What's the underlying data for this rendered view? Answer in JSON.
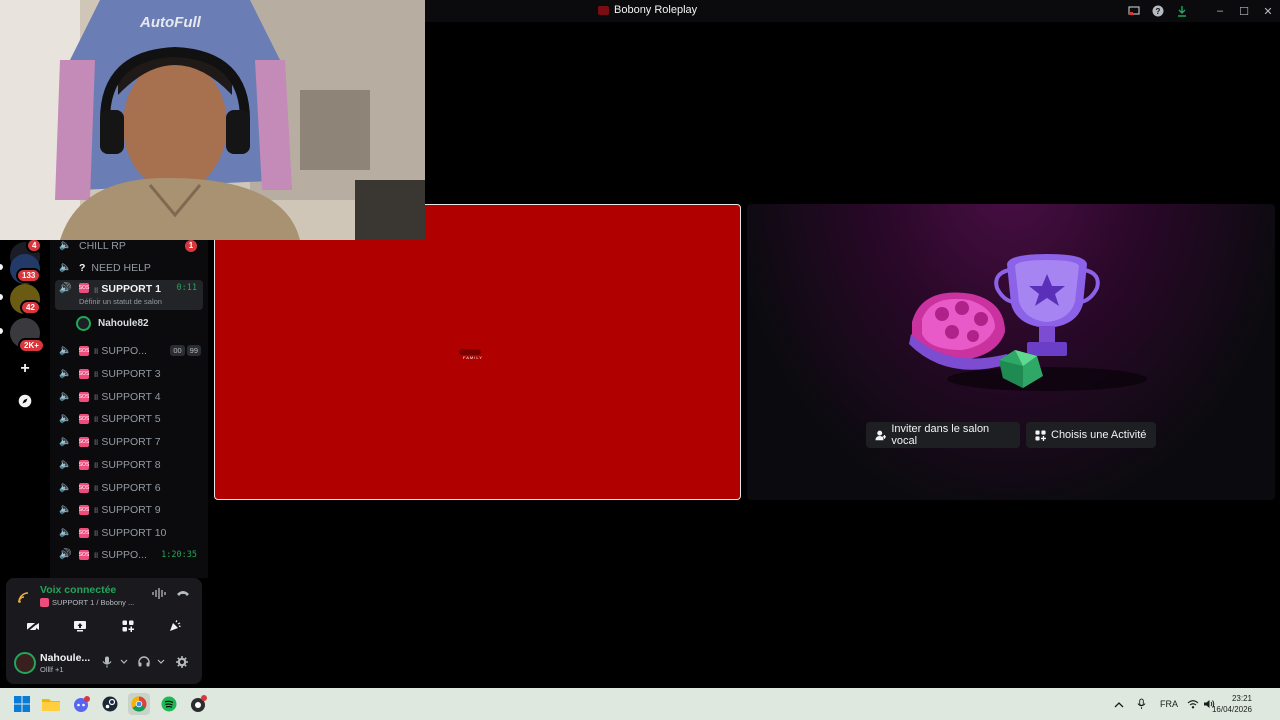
{
  "window": {
    "title": "Bobony Roleplay",
    "icons": [
      "screen-share-icon",
      "help-icon",
      "download-icon"
    ],
    "controls": [
      "–",
      "☐",
      "✕"
    ]
  },
  "rail": {
    "badges": [
      "4",
      "133",
      "42",
      "2K+"
    ],
    "add_server": "+",
    "discover": "🧭"
  },
  "channels": [
    {
      "name": "CHILL RP",
      "unread": "1"
    },
    {
      "name": "NEED HELP",
      "prefix": "?"
    },
    {
      "name": "SUPPORT 1",
      "time": "0:11",
      "sub": "Définir un statut de salon"
    },
    {
      "name": "SUPPO...",
      "cap1": "00",
      "cap2": "99"
    },
    {
      "name": "SUPPORT 3"
    },
    {
      "name": "SUPPORT 4"
    },
    {
      "name": "SUPPORT 5"
    },
    {
      "name": "SUPPORT 7"
    },
    {
      "name": "SUPPORT 8"
    },
    {
      "name": "SUPPORT 6"
    },
    {
      "name": "SUPPORT 9"
    },
    {
      "name": "SUPPORT 10"
    },
    {
      "name": "SUPPO...",
      "time": "1:20:35"
    }
  ],
  "member": {
    "name": "Nahoule82"
  },
  "voice": {
    "status": "Voix connectée",
    "channel": "SUPPORT 1 / Bobony ..."
  },
  "user": {
    "name": "Nahoule...",
    "status": "Olllf +1"
  },
  "stage": {
    "red_tile_text": "FAMILY",
    "invite_label": "Inviter dans le salon vocal",
    "activity_label": "Choisis une Activité"
  },
  "taskbar": {
    "lang": "FRA",
    "time": "23:21",
    "date": "16/04/2026"
  }
}
